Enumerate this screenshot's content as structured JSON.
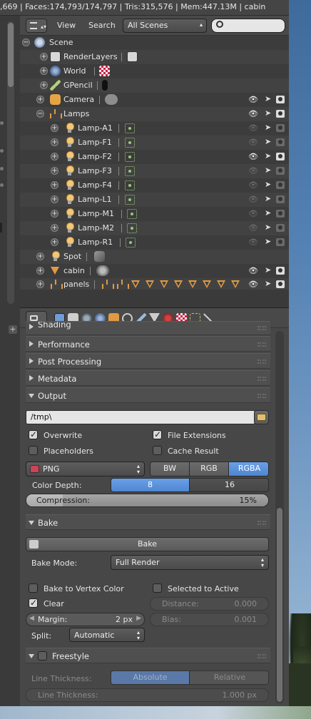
{
  "infobar": {
    "text": ",669 | Faces:174,793/174,797 | Tris:315,576 | Mem:447.13M | cabin"
  },
  "outliner": {
    "menu_view": "View",
    "menu_search": "Search",
    "display_mode": "All Scenes",
    "search_placeholder": "",
    "rows": [
      {
        "label": "Scene"
      },
      {
        "label": "RenderLayers"
      },
      {
        "label": "World"
      },
      {
        "label": "GPencil"
      },
      {
        "label": "Camera"
      },
      {
        "label": "Lamps"
      },
      {
        "label": "Lamp-A1"
      },
      {
        "label": "Lamp-F1"
      },
      {
        "label": "Lamp-F2"
      },
      {
        "label": "Lamp-F3"
      },
      {
        "label": "Lamp-F4"
      },
      {
        "label": "Lamp-L1"
      },
      {
        "label": "Lamp-M1"
      },
      {
        "label": "Lamp-M2"
      },
      {
        "label": "Lamp-R1"
      },
      {
        "label": "Spot"
      },
      {
        "label": "cabin"
      },
      {
        "label": "panels"
      }
    ]
  },
  "properties": {
    "panels": {
      "shading": "Shading",
      "performance": "Performance",
      "post_processing": "Post Processing",
      "metadata": "Metadata",
      "output": "Output",
      "bake": "Bake",
      "freestyle": "Freestyle"
    },
    "output": {
      "path": "/tmp\\",
      "overwrite": "Overwrite",
      "file_extensions": "File Extensions",
      "placeholders": "Placeholders",
      "cache_result": "Cache Result",
      "format": "PNG",
      "color_modes": [
        "BW",
        "RGB",
        "RGBA"
      ],
      "color_mode_selected": "RGBA",
      "color_depth_label": "Color Depth:",
      "color_depths": [
        "8",
        "16"
      ],
      "color_depth_selected": "8",
      "compression_label": "Compression:",
      "compression_value": "15%",
      "compression_fraction": 0.15
    },
    "bake": {
      "bake_button": "Bake",
      "mode_label": "Bake Mode:",
      "mode_value": "Full Render",
      "bake_to_vertex_color": "Bake to Vertex Color",
      "selected_to_active": "Selected to Active",
      "clear": "Clear",
      "distance_label": "Distance:",
      "distance_value": "0.000",
      "margin_label": "Margin:",
      "margin_value": "2 px",
      "bias_label": "Bias:",
      "bias_value": "0.001",
      "split_label": "Split:",
      "split_value": "Automatic"
    },
    "freestyle": {
      "line_thickness_label": "Line Thickness:",
      "modes": [
        "Absolute",
        "Relative"
      ],
      "mode_selected": "Absolute",
      "line_thickness_field_label": "Line Thickness:",
      "line_thickness_value": "1.000 px"
    }
  },
  "colors": {
    "accent_blue": "#5b92dc",
    "lamp_yellow": "#f2c778",
    "mesh_orange": "#e09a44"
  }
}
